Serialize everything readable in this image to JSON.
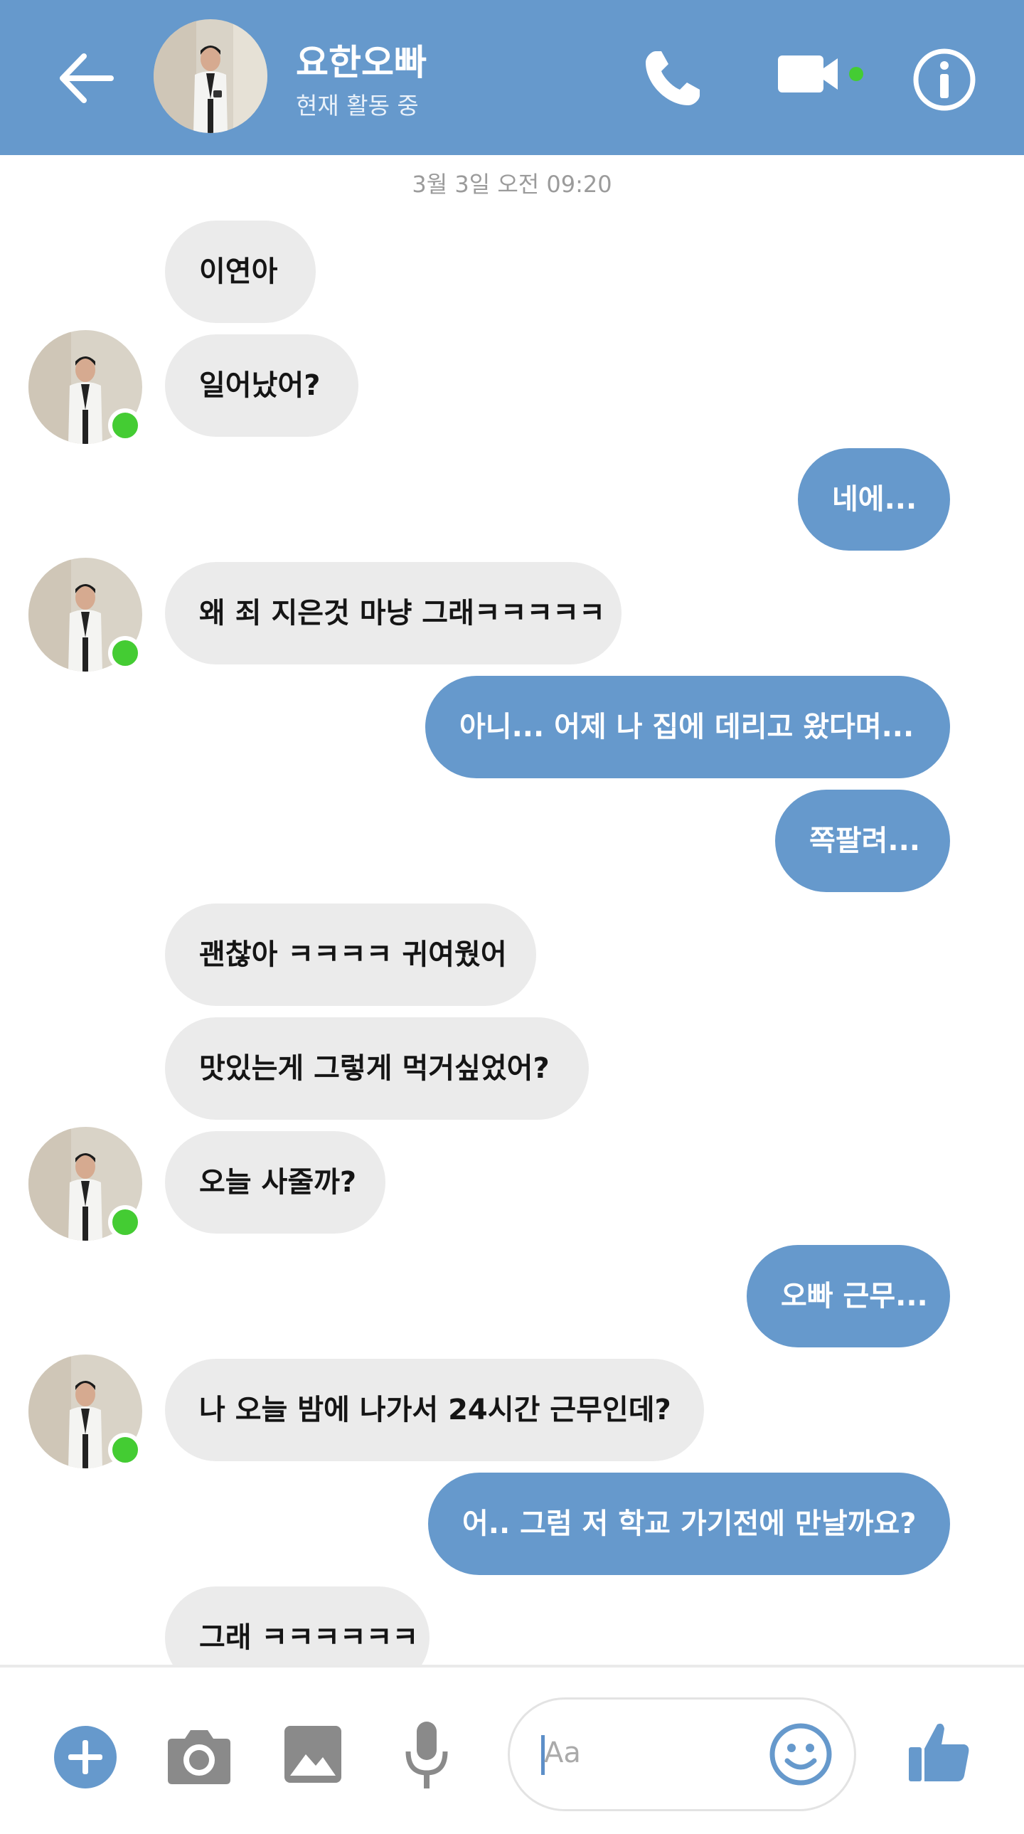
{
  "header": {
    "contact_name": "요한오빠",
    "status": "현재 활동 중",
    "icons": {
      "back": "arrow-left-icon",
      "call": "phone-icon",
      "video": "video-camera-icon",
      "info": "info-icon"
    },
    "online_color": "#44cc33"
  },
  "chat": {
    "timestamp": "3월 3일 오전 09:20",
    "messages": [
      {
        "from": "other",
        "text": "이연아"
      },
      {
        "from": "other",
        "text": "일어났어?"
      },
      {
        "from": "me",
        "text": "네에..."
      },
      {
        "from": "other",
        "text": "왜 죄 지은것 마냥 그래ㅋㅋㅋㅋㅋ"
      },
      {
        "from": "me",
        "text": "아니... 어제 나 집에 데리고 왔다며..."
      },
      {
        "from": "me",
        "text": "쪽팔려..."
      },
      {
        "from": "other",
        "text": "괜찮아 ㅋㅋㅋㅋ 귀여웠어"
      },
      {
        "from": "other",
        "text": "맛있는게 그렇게 먹거싶었어?"
      },
      {
        "from": "other",
        "text": "오늘 사줄까?"
      },
      {
        "from": "me",
        "text": "오빠 근무..."
      },
      {
        "from": "other",
        "text": "나 오늘 밤에 나가서 24시간 근무인데?"
      },
      {
        "from": "me",
        "text": "어.. 그럼 저 학교 가기전에 만날까요?"
      },
      {
        "from": "other",
        "text": "그래 ㅋㅋㅋㅋㅋㅋ"
      }
    ]
  },
  "composer": {
    "placeholder": "Aa",
    "icons": {
      "plus": "plus-circle-icon",
      "camera": "camera-icon",
      "gallery": "image-icon",
      "mic": "microphone-icon",
      "emoji": "smiley-icon",
      "like": "thumbs-up-icon"
    }
  },
  "colors": {
    "accent": "#6699cc",
    "incoming_bubble": "#ebebeb",
    "timestamp": "#9b9b9b"
  }
}
